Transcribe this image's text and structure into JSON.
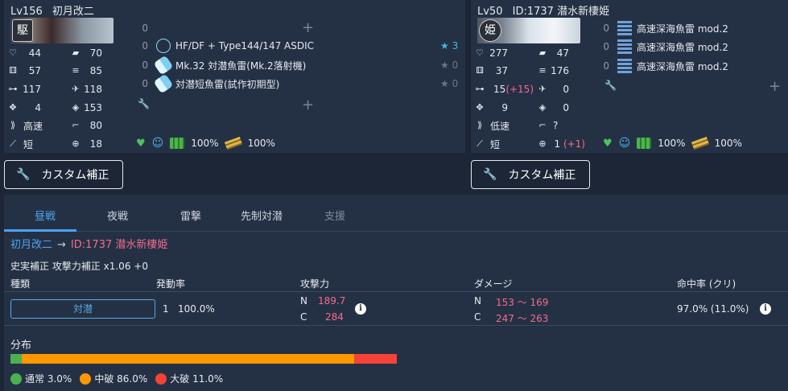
{
  "colors": {
    "accent": "#4da3f0",
    "pink": "#f56b8a",
    "panel": "#243145",
    "bg": "#1c2636",
    "star": "#3fb8e8",
    "normal": "#4caf50",
    "medium": "#ff9800",
    "heavy": "#f44336"
  },
  "attacker": {
    "level": "Lv156",
    "name": "初月改二",
    "badge": "駆",
    "stats": {
      "hp": "44",
      "armor": "70",
      "evasion": "57",
      "aa": "85",
      "asw": "117",
      "los": "118",
      "luck": "4",
      "torpedo": "153",
      "speed": "高速",
      "firepower": "80",
      "range": "短",
      "accuracy": "18"
    },
    "slots": [
      {
        "count": "0",
        "icon": "empty-slot",
        "name": ""
      },
      {
        "count": "0",
        "icon": "sonar-icon",
        "name": "HF/DF + Type144/147 ASDIC",
        "star": "★ 3",
        "star_on": true
      },
      {
        "count": "0",
        "icon": "depth-charge-icon",
        "name": "Mk.32 対潜魚雷(Mk.2落射機)",
        "star": "★ 0",
        "star_on": false
      },
      {
        "count": "0",
        "icon": "depth-charge-icon",
        "name": "対潜短魚雷(試作初期型)",
        "star": "★ 0",
        "star_on": false
      }
    ],
    "fuel": "100%",
    "ammo": "100%"
  },
  "defender": {
    "level": "Lv50",
    "name": "ID:1737 潜水新棲姫",
    "badge": "姫",
    "stats": {
      "hp": "277",
      "armor": "47",
      "evasion": "37",
      "aa": "176",
      "asw_base": "15",
      "asw_bonus": "(+15)",
      "los": "0",
      "luck": "9",
      "torpedo": "0",
      "speed": "低速",
      "firepower": "?",
      "range": "短",
      "accuracy_base": "1",
      "accuracy_bonus": "(+1)"
    },
    "slots": [
      {
        "count": "0",
        "icon": "torpedo-icon",
        "name": "高速深海魚雷 mod.2"
      },
      {
        "count": "0",
        "icon": "torpedo-icon",
        "name": "高速深海魚雷 mod.2"
      },
      {
        "count": "0",
        "icon": "torpedo-icon",
        "name": "高速深海魚雷 mod.2"
      }
    ],
    "fuel": "100%",
    "ammo": "100%"
  },
  "buttons": {
    "custom_bonus": "カスタム補正"
  },
  "tabs": [
    {
      "label": "昼戦",
      "state": "active"
    },
    {
      "label": "夜戦",
      "state": "normal"
    },
    {
      "label": "雷撃",
      "state": "normal"
    },
    {
      "label": "先制対潜",
      "state": "normal"
    },
    {
      "label": "支援",
      "state": "disabled"
    }
  ],
  "route": {
    "attacker": "初月改二",
    "arrow": "→",
    "defender": "ID:1737 潜水新棲姫"
  },
  "historical_bonus": "史実補正 攻撃力補正 x1.06 +0",
  "table": {
    "headers": {
      "type": "種類",
      "rate": "発動率",
      "power": "攻撃力",
      "damage": "ダメージ",
      "hit": "命中率 (クリ)"
    },
    "row": {
      "type": "対潜",
      "count": "1",
      "rate": "100.0%",
      "power_n_label": "N",
      "power_n": "189.7",
      "power_c_label": "C",
      "power_c": "284",
      "damage_n_label": "N",
      "damage_n": "153 ～ 169",
      "damage_c_label": "C",
      "damage_c": "247 ～ 263",
      "hit": "97.0% (11.0%)"
    }
  },
  "distribution": {
    "title": "分布",
    "normal_label": "通常 3.0%",
    "normal": 0.03,
    "medium_label": "中破 86.0%",
    "medium": 0.86,
    "heavy_label": "大破 11.0%",
    "heavy": 0.11
  }
}
